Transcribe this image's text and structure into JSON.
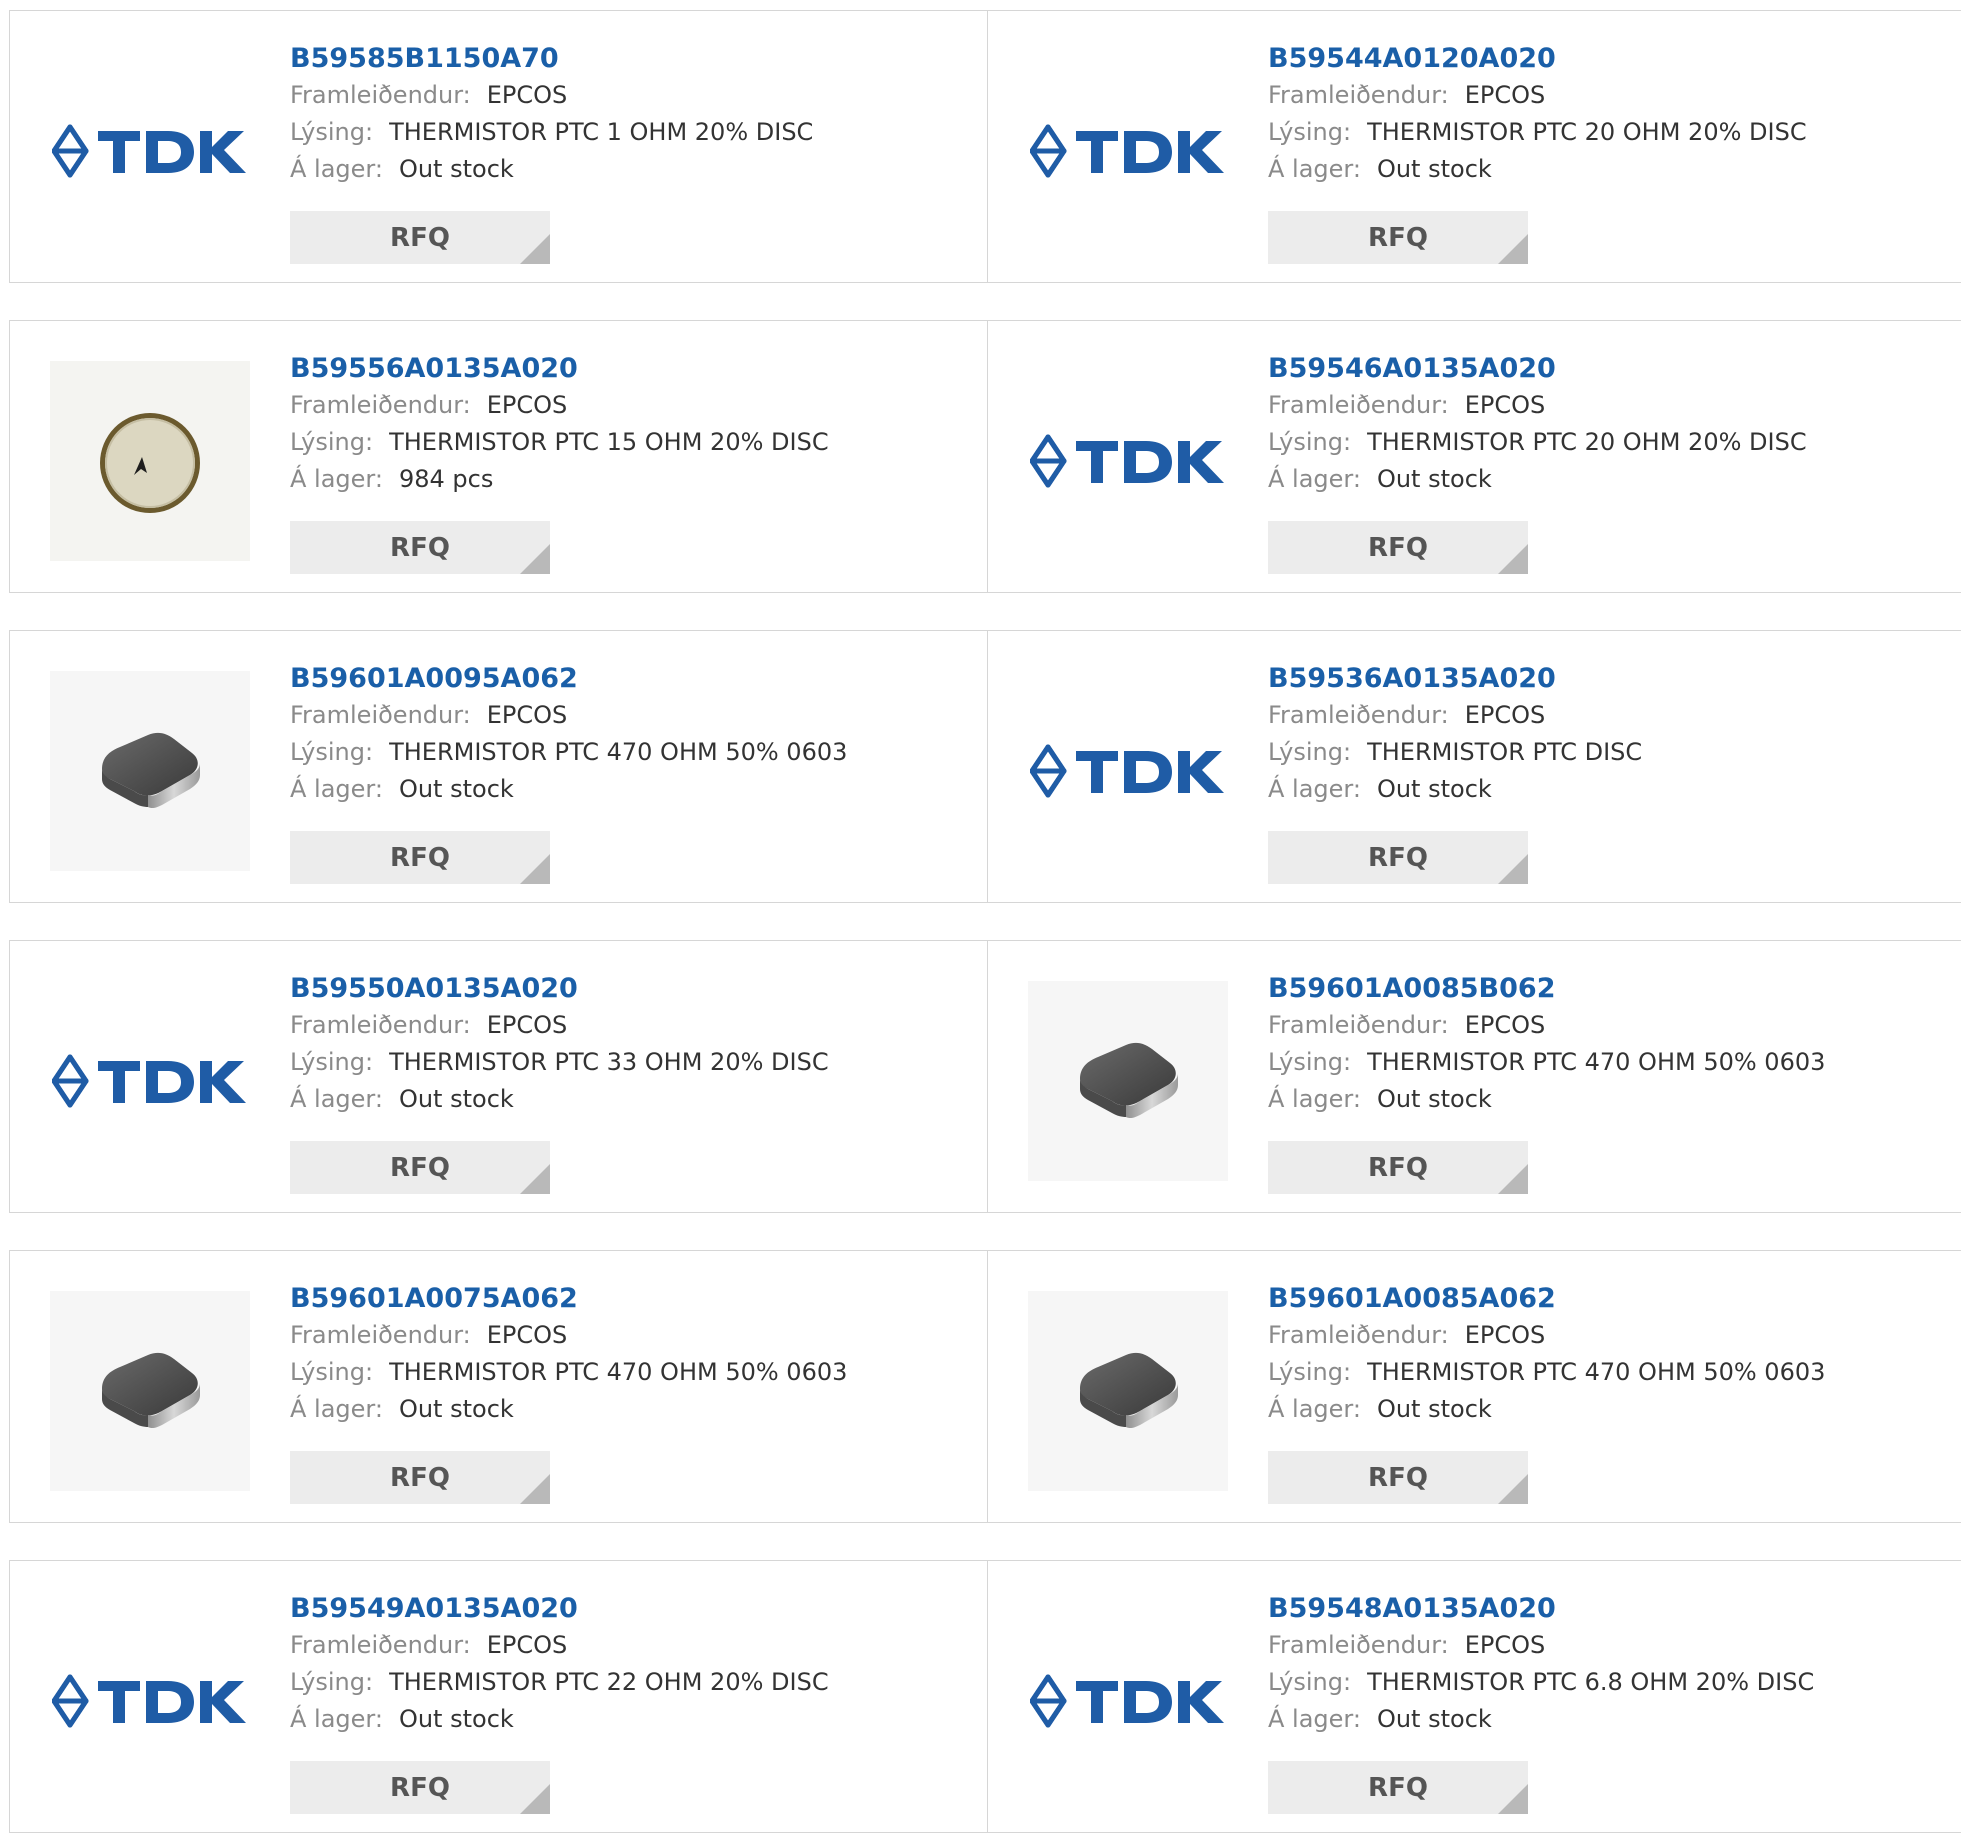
{
  "labels": {
    "manufacturer": "Framleiðendur:",
    "description": "Lýsing:",
    "stock": "Á lager:"
  },
  "products": [
    {
      "part": "B59585B1150A70",
      "manufacturer": "EPCOS",
      "description": "THERMISTOR PTC 1 OHM 20% DISC",
      "stock": "Out stock",
      "image": "tdk-logo",
      "button": "RFQ"
    },
    {
      "part": "B59544A0120A020",
      "manufacturer": "EPCOS",
      "description": "THERMISTOR PTC 20 OHM 20% DISC",
      "stock": "Out stock",
      "image": "tdk-logo",
      "button": "RFQ"
    },
    {
      "part": "B59556A0135A020",
      "manufacturer": "EPCOS",
      "description": "THERMISTOR PTC 15 OHM 20% DISC",
      "stock": "984 pcs",
      "image": "disc-thermistor",
      "button": "RFQ"
    },
    {
      "part": "B59546A0135A020",
      "manufacturer": "EPCOS",
      "description": "THERMISTOR PTC 20 OHM 20% DISC",
      "stock": "Out stock",
      "image": "tdk-logo",
      "button": "RFQ"
    },
    {
      "part": "B59601A0095A062",
      "manufacturer": "EPCOS",
      "description": "THERMISTOR PTC 470 OHM 50% 0603",
      "stock": "Out stock",
      "image": "smd-chip",
      "button": "RFQ"
    },
    {
      "part": "B59536A0135A020",
      "manufacturer": "EPCOS",
      "description": "THERMISTOR PTC DISC",
      "stock": "Out stock",
      "image": "tdk-logo",
      "button": "RFQ"
    },
    {
      "part": "B59550A0135A020",
      "manufacturer": "EPCOS",
      "description": "THERMISTOR PTC 33 OHM 20% DISC",
      "stock": "Out stock",
      "image": "tdk-logo",
      "button": "RFQ"
    },
    {
      "part": "B59601A0085B062",
      "manufacturer": "EPCOS",
      "description": "THERMISTOR PTC 470 OHM 50% 0603",
      "stock": "Out stock",
      "image": "smd-chip",
      "button": "RFQ"
    },
    {
      "part": "B59601A0075A062",
      "manufacturer": "EPCOS",
      "description": "THERMISTOR PTC 470 OHM 50% 0603",
      "stock": "Out stock",
      "image": "smd-chip",
      "button": "RFQ"
    },
    {
      "part": "B59601A0085A062",
      "manufacturer": "EPCOS",
      "description": "THERMISTOR PTC 470 OHM 50% 0603",
      "stock": "Out stock",
      "image": "smd-chip",
      "button": "RFQ"
    },
    {
      "part": "B59549A0135A020",
      "manufacturer": "EPCOS",
      "description": "THERMISTOR PTC 22 OHM 20% DISC",
      "stock": "Out stock",
      "image": "tdk-logo",
      "button": "RFQ"
    },
    {
      "part": "B59548A0135A020",
      "manufacturer": "EPCOS",
      "description": "THERMISTOR PTC 6.8 OHM 20% DISC",
      "stock": "Out stock",
      "image": "tdk-logo",
      "button": "RFQ"
    }
  ],
  "colors": {
    "link": "#1a5fa8",
    "tdk_brand": "#1f5ca6",
    "label": "#8a8a8a",
    "value": "#333333",
    "border": "#d6d6d6",
    "button_bg": "#ececec"
  }
}
